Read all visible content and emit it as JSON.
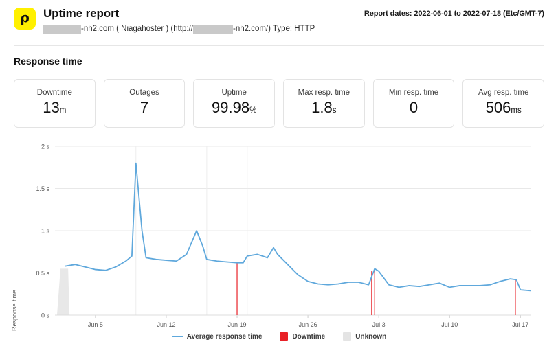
{
  "header": {
    "logo_glyph": "ρ",
    "logo_color": "#fff000",
    "title": "Uptime report",
    "subtitle_parts": {
      "after_first_redaction": "-nh2.com ( Niagahoster ) (http://",
      "after_second_redaction": "-nh2.com/) Type: HTTP"
    },
    "report_dates": "Report dates: 2022-06-01 to 2022-07-18 (Etc/GMT-7)"
  },
  "section": {
    "title": "Response time"
  },
  "cards": [
    {
      "label": "Downtime",
      "value": "13",
      "unit": "m"
    },
    {
      "label": "Outages",
      "value": "7",
      "unit": ""
    },
    {
      "label": "Uptime",
      "value": "99.98",
      "unit": "%"
    },
    {
      "label": "Max resp. time",
      "value": "1.8",
      "unit": "s"
    },
    {
      "label": "Min resp. time",
      "value": "0",
      "unit": ""
    },
    {
      "label": "Avg resp. time",
      "value": "506",
      "unit": "ms"
    }
  ],
  "legend": [
    {
      "name": "Average response time",
      "type": "line",
      "color": "#5fa8dc"
    },
    {
      "name": "Downtime",
      "type": "swatch",
      "color": "#e82127"
    },
    {
      "name": "Unknown",
      "type": "swatch",
      "color": "#e4e4e4"
    }
  ],
  "chart_data": {
    "type": "line",
    "title": "Response time",
    "xlabel": "",
    "ylabel": "Response time",
    "ylim": [
      0,
      2
    ],
    "y_unit": "s",
    "grid": true,
    "legend_position": "bottom",
    "y_ticks": [
      0,
      0.5,
      1,
      1.5,
      2
    ],
    "y_tick_labels": [
      "0 s",
      "0.5 s",
      "1 s",
      "1.5 s",
      "2 s"
    ],
    "x_ticks": [
      "Jun 5",
      "Jun 12",
      "Jun 19",
      "Jun 26",
      "Jul 3",
      "Jul 10",
      "Jul 17"
    ],
    "x_tick_days": [
      4,
      11,
      18,
      25,
      32,
      39,
      46
    ],
    "x_range_days": [
      0,
      47
    ],
    "series": [
      {
        "name": "Average response time",
        "color": "#5fa8dc",
        "x_days": [
          1,
          2,
          3,
          4,
          5,
          6,
          7,
          7.6,
          8,
          8.6,
          9,
          10,
          11,
          12,
          13,
          14,
          14.6,
          15,
          16,
          17,
          18,
          18.6,
          19,
          20,
          21,
          21.6,
          22,
          23,
          24,
          25,
          26,
          27,
          28,
          29,
          30,
          31,
          31.6,
          32,
          33,
          34,
          35,
          36,
          37,
          38,
          39,
          40,
          41,
          42,
          43,
          44,
          45,
          45.6,
          46,
          47
        ],
        "values": [
          0.58,
          0.6,
          0.57,
          0.54,
          0.53,
          0.57,
          0.64,
          0.7,
          1.8,
          1.0,
          0.68,
          0.66,
          0.65,
          0.64,
          0.72,
          1.0,
          0.82,
          0.66,
          0.64,
          0.63,
          0.62,
          0.62,
          0.7,
          0.72,
          0.68,
          0.8,
          0.72,
          0.6,
          0.48,
          0.4,
          0.37,
          0.36,
          0.37,
          0.39,
          0.39,
          0.36,
          0.55,
          0.52,
          0.36,
          0.33,
          0.35,
          0.34,
          0.36,
          0.38,
          0.33,
          0.35,
          0.35,
          0.35,
          0.36,
          0.4,
          0.43,
          0.42,
          0.3,
          0.29
        ]
      }
    ],
    "downtime_markers": [
      {
        "x_day": 18.0,
        "top_value": 0.62
      },
      {
        "x_day": 31.3,
        "top_value": 0.52
      },
      {
        "x_day": 31.6,
        "top_value": 0.52
      },
      {
        "x_day": 45.5,
        "top_value": 0.42
      }
    ],
    "unknown_regions": [
      {
        "start_day": 0.2,
        "end_day": 1.3,
        "note": "shaded unknown band at start"
      }
    ]
  }
}
